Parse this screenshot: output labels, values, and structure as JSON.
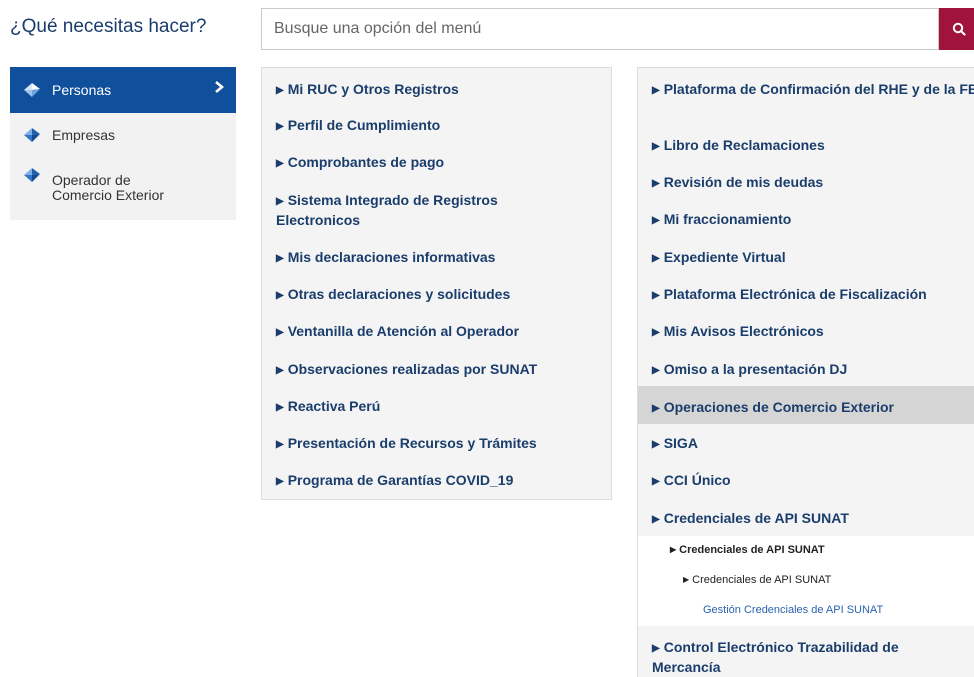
{
  "header": {
    "title": "¿Qué necesitas hacer?"
  },
  "search": {
    "placeholder": "Busque una opción del menú"
  },
  "sidebar": {
    "items": [
      {
        "label": "Personas"
      },
      {
        "label": "Empresas"
      },
      {
        "label": "Operador de\nComercio Exterior"
      }
    ]
  },
  "left_menu": {
    "items": [
      "Mi RUC y Otros Registros",
      "Perfil de Cumplimiento",
      "Comprobantes de pago",
      "Sistema Integrado de Registros Electronicos",
      "Mis declaraciones informativas",
      "Otras declaraciones y solicitudes",
      "Ventanilla de Atención al Operador",
      "Observaciones realizadas por SUNAT",
      "Reactiva Perú",
      "Presentación de Recursos y Trámites",
      "Programa de Garantías COVID_19"
    ]
  },
  "right_menu": {
    "items": [
      "Plataforma de Confirmación del RHE y de la FE",
      "Libro de Reclamaciones",
      "Revisión de mis deudas",
      "Mi fraccionamiento",
      "Expediente Virtual",
      "Plataforma Electrónica de Fiscalización",
      "Mis Avisos Electrónicos",
      "Omiso a la presentación DJ",
      "Operaciones de Comercio Exterior",
      "SIGA",
      "CCI Único",
      "Credenciales de API SUNAT",
      "Control Electrónico Trazabilidad de Mercancía"
    ],
    "submenu": {
      "level1": "Credenciales de API SUNAT",
      "level2": "Credenciales de API SUNAT",
      "level3": "Gestión Credenciales de API SUNAT"
    }
  },
  "colors": {
    "brand_blue": "#104f9c",
    "search_button": "#a0143c",
    "menu_text": "#1a3d6b",
    "link_blue": "#2a63b0"
  },
  "icons": {
    "search": "search-icon",
    "sidebar_bullet": "diamond-icon",
    "sidebar_active_arrow": "chevron-right-icon",
    "menu_bullet": "triangle-right-icon"
  }
}
